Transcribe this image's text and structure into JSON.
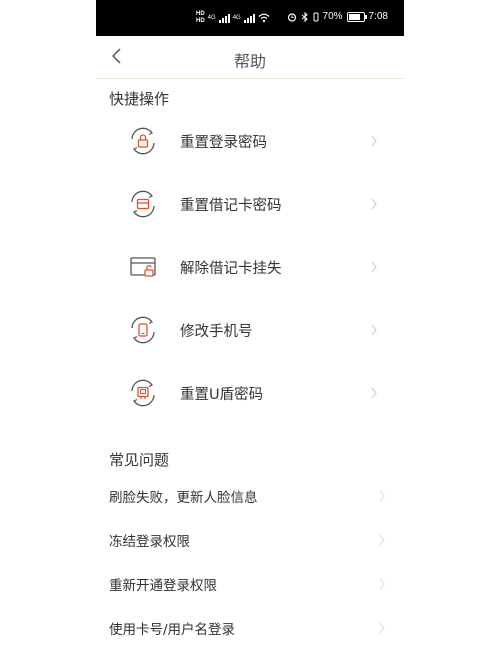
{
  "status_bar": {
    "hd_top": "HD",
    "hd_bottom": "HD",
    "net1": "4G",
    "net2": "4G",
    "battery_percent": "70%",
    "time": "7:08"
  },
  "header": {
    "title": "帮助"
  },
  "quick_ops": {
    "title": "快捷操作",
    "items": [
      {
        "label": "重置登录密码",
        "icon": "lock-reset-icon"
      },
      {
        "label": "重置借记卡密码",
        "icon": "card-reset-icon"
      },
      {
        "label": "解除借记卡挂失",
        "icon": "card-unlock-icon"
      },
      {
        "label": "修改手机号",
        "icon": "phone-change-icon"
      },
      {
        "label": "重置U盾密码",
        "icon": "ukey-reset-icon"
      }
    ]
  },
  "faq": {
    "title": "常见问题",
    "items": [
      {
        "label": "刷脸失败，更新人脸信息"
      },
      {
        "label": "冻结登录权限"
      },
      {
        "label": "重新开通登录权限"
      },
      {
        "label": "使用卡号/用户名登录"
      }
    ]
  },
  "colors": {
    "accent": "#d9542b",
    "icon_gray": "#555555",
    "chevron": "#d8cdb9"
  }
}
